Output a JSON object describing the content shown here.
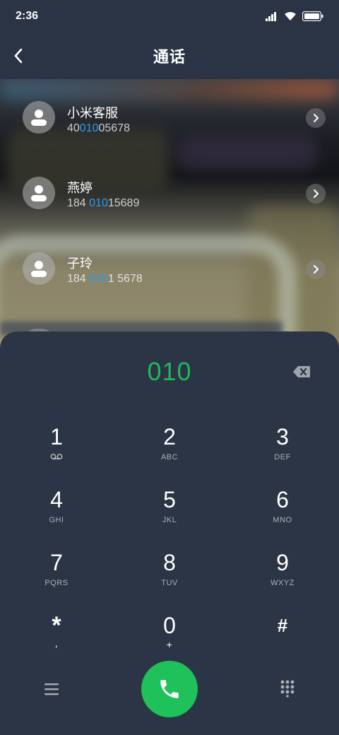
{
  "status": {
    "time": "2:36"
  },
  "header": {
    "title": "通话"
  },
  "contacts": [
    {
      "name": "小米客服",
      "number_pre": "40",
      "number_hl": "010",
      "number_post": "05678"
    },
    {
      "name": "燕婷",
      "number_pre": "184 ",
      "number_hl": "010",
      "number_post": "15689"
    },
    {
      "name": "子玲",
      "number_pre": "184 ",
      "number_hl": "010",
      "number_post": "1 5678"
    }
  ],
  "dialer": {
    "input": "010",
    "keys": [
      {
        "digit": "1",
        "letters": ""
      },
      {
        "digit": "2",
        "letters": "ABC"
      },
      {
        "digit": "3",
        "letters": "DEF"
      },
      {
        "digit": "4",
        "letters": "GHI"
      },
      {
        "digit": "5",
        "letters": "JKL"
      },
      {
        "digit": "6",
        "letters": "MNO"
      },
      {
        "digit": "7",
        "letters": "PQRS"
      },
      {
        "digit": "8",
        "letters": "TUV"
      },
      {
        "digit": "9",
        "letters": "WXYZ"
      },
      {
        "digit": "*",
        "letters": ","
      },
      {
        "digit": "0",
        "letters": "+"
      },
      {
        "digit": "#",
        "letters": ""
      }
    ]
  },
  "colors": {
    "background": "#2a3444",
    "dialer": "#2b3545",
    "accent_green": "#1ec15a",
    "highlight_blue": "#2e9bf0"
  },
  "icons": {
    "back": "chevron-left-icon",
    "voicemail": "voicemail-icon",
    "backspace": "backspace-icon",
    "menu": "menu-icon",
    "call": "phone-icon",
    "keypad": "keypad-icon"
  }
}
